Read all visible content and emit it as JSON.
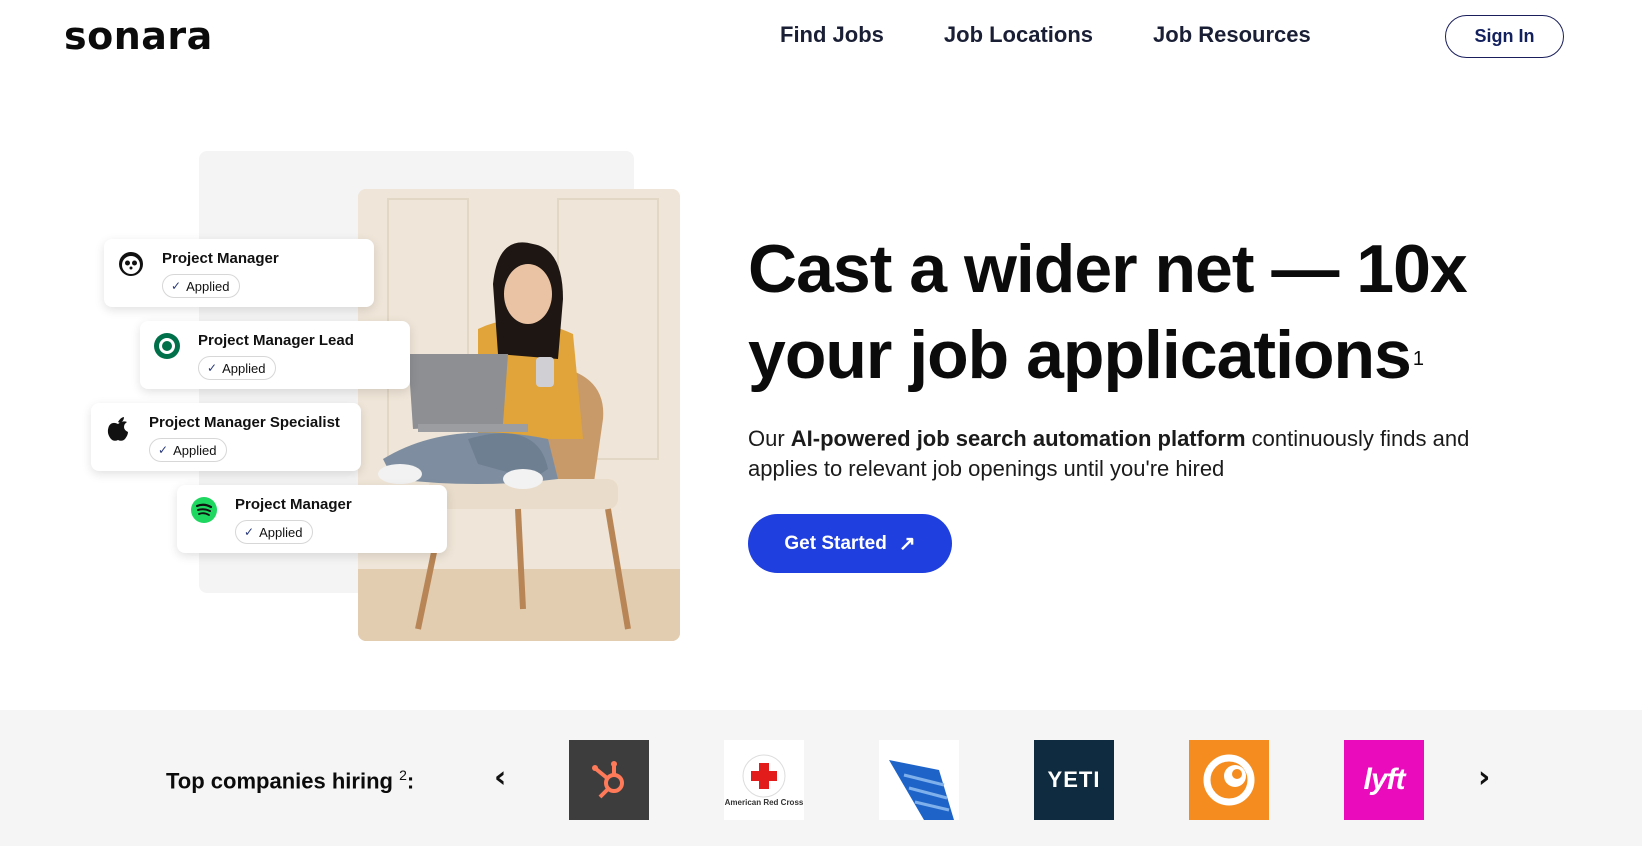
{
  "header": {
    "logo": "sonara",
    "nav": [
      "Find Jobs",
      "Job Locations",
      "Job Resources"
    ],
    "sign_in": "Sign In"
  },
  "cards": [
    {
      "title": "Project Manager",
      "status": "Applied",
      "company_icon": "panda-icon"
    },
    {
      "title": "Project Manager Lead",
      "status": "Applied",
      "company_icon": "starbucks-icon"
    },
    {
      "title": "Project Manager Specialist",
      "status": "Applied",
      "company_icon": "apple-icon"
    },
    {
      "title": "Project Manager",
      "status": "Applied",
      "company_icon": "spotify-icon"
    }
  ],
  "hero": {
    "headline_line1": "Cast a wider net — 10x",
    "headline_line2": "your job applications",
    "headline_sup": "1",
    "sub_prefix": "Our ",
    "sub_bold": "AI-powered job search automation platform",
    "sub_suffix": " continuously finds and applies to relevant job openings until you're hired",
    "cta": "Get Started"
  },
  "companies": {
    "label": "Top companies hiring",
    "label_sup": "2",
    "label_colon": ":",
    "logos": [
      {
        "name": "hubspot-logo",
        "bg": "#3d3d3d"
      },
      {
        "name": "american-red-cross-logo",
        "bg": "#ffffff",
        "text": "American Red Cross"
      },
      {
        "name": "united-logo",
        "bg": "#ffffff"
      },
      {
        "name": "yeti-logo",
        "bg": "#0f2b3f",
        "text": "YETI"
      },
      {
        "name": "crunchyroll-logo",
        "bg": "#f58c1f"
      },
      {
        "name": "lyft-logo",
        "bg": "#ea0bbd",
        "text": "lyft"
      }
    ]
  },
  "colors": {
    "accent": "#1f3fde",
    "nav_text": "#1a1f36",
    "strip_bg": "#f5f5f5"
  }
}
